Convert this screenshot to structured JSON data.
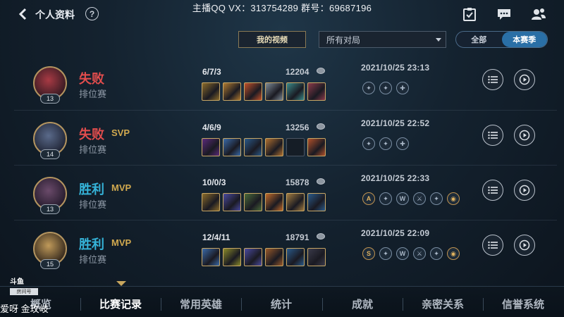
{
  "header": {
    "title": "个人资料",
    "help": "?",
    "streamer_info": "主播QQ VX：313754289   群号：69687196",
    "icons": [
      "clipboard-check-icon",
      "chat-bubble-icon",
      "friends-icon"
    ]
  },
  "filters": {
    "my_videos": "我的视频",
    "match_type": "所有对局",
    "season_all": "全部",
    "season_current": "本赛季"
  },
  "matches": [
    {
      "result": "失败",
      "result_type": "loss",
      "badge": "",
      "mode": "排位赛",
      "level": "13",
      "kda": "6/7/3",
      "gold": "12204",
      "datetime": "2021/10/25 23:13",
      "items": [
        "#8a6a2a",
        "#b07a30",
        "#c1502a",
        "#7d8a96",
        "#3a8a8a",
        "#8a3a4a"
      ],
      "runes": [
        {
          "g": "✦",
          "t": "n"
        },
        {
          "g": "✦",
          "t": "n"
        },
        {
          "g": "✚",
          "t": "n"
        }
      ],
      "avatar_colors": [
        "#a83a44",
        "#2d1820"
      ]
    },
    {
      "result": "失败",
      "result_type": "loss",
      "badge": "SVP",
      "mode": "排位赛",
      "level": "14",
      "kda": "4/6/9",
      "gold": "13256",
      "datetime": "2021/10/25 22:52",
      "items": [
        "#5a2a7a",
        "#3a6aa8",
        "#2a5a8a",
        "#b07030",
        "",
        "#b0502a"
      ],
      "runes": [
        {
          "g": "✦",
          "t": "n"
        },
        {
          "g": "✦",
          "t": "n"
        },
        {
          "g": "✚",
          "t": "n"
        }
      ],
      "avatar_colors": [
        "#5a6a8a",
        "#1c2030"
      ]
    },
    {
      "result": "胜利",
      "result_type": "win",
      "badge": "MVP",
      "mode": "排位赛",
      "level": "13",
      "kda": "10/0/3",
      "gold": "15878",
      "datetime": "2021/10/25 22:33",
      "items": [
        "#8a6a2a",
        "#4a4aa0",
        "#4a6a3a",
        "#c06a2a",
        "#a07a40",
        "#2a5a8a"
      ],
      "runes": [
        {
          "g": "A",
          "t": "g"
        },
        {
          "g": "✦",
          "t": "n"
        },
        {
          "g": "W",
          "t": "n"
        },
        {
          "g": "⚔",
          "t": "n"
        },
        {
          "g": "✦",
          "t": "n"
        },
        {
          "g": "◉",
          "t": "g"
        }
      ],
      "avatar_colors": [
        "#6a4a6a",
        "#201828"
      ]
    },
    {
      "result": "胜利",
      "result_type": "win",
      "badge": "MVP",
      "mode": "排位赛",
      "level": "15",
      "kda": "12/4/11",
      "gold": "18791",
      "datetime": "2021/10/25 22:09",
      "items": [
        "#3a6aa8",
        "#8a8a2a",
        "#4a4aa0",
        "#9a5a2a",
        "#2a5a8a",
        "#3a3a4a"
      ],
      "runes": [
        {
          "g": "S",
          "t": "g"
        },
        {
          "g": "✦",
          "t": "n"
        },
        {
          "g": "W",
          "t": "n"
        },
        {
          "g": "⚔",
          "t": "n"
        },
        {
          "g": "✦",
          "t": "n"
        },
        {
          "g": "◉",
          "t": "g"
        }
      ],
      "avatar_colors": [
        "#c09a5a",
        "#2a2018"
      ]
    }
  ],
  "tabs": [
    {
      "label": "概览",
      "active": false
    },
    {
      "label": "比赛记录",
      "active": true
    },
    {
      "label": "常用英雄",
      "active": false
    },
    {
      "label": "统计",
      "active": false
    },
    {
      "label": "成就",
      "active": false
    },
    {
      "label": "亲密关系",
      "active": false
    },
    {
      "label": "信誉系统",
      "active": false
    }
  ],
  "watermark": {
    "logo": "斗鱼",
    "box": "房间号",
    "text": "爱呀   金玫岐"
  },
  "colors": {
    "loss": "#e24d4d",
    "win": "#35b3d8",
    "badge_gold": "#d1a94f",
    "toggle_active": "#2a6fa6"
  }
}
